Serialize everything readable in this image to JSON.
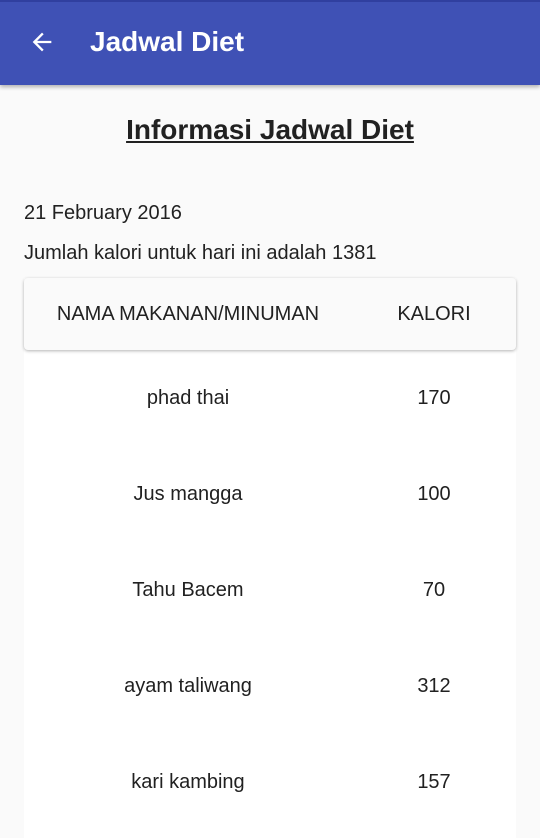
{
  "appbar": {
    "title": "Jadwal Diet",
    "back_icon": "arrow-left-icon"
  },
  "heading": "Informasi Jadwal Diet",
  "date": "21 February 2016",
  "total_text": "Jumlah kalori untuk hari ini adalah 1381",
  "table": {
    "headers": [
      "NAMA MAKANAN/MINUMAN",
      "KALORI"
    ],
    "rows": [
      {
        "name": "phad thai",
        "kalori": "170"
      },
      {
        "name": "Jus mangga",
        "kalori": "100"
      },
      {
        "name": "Tahu Bacem",
        "kalori": "70"
      },
      {
        "name": "ayam taliwang",
        "kalori": "312"
      },
      {
        "name": "kari kambing",
        "kalori": "157"
      }
    ]
  }
}
